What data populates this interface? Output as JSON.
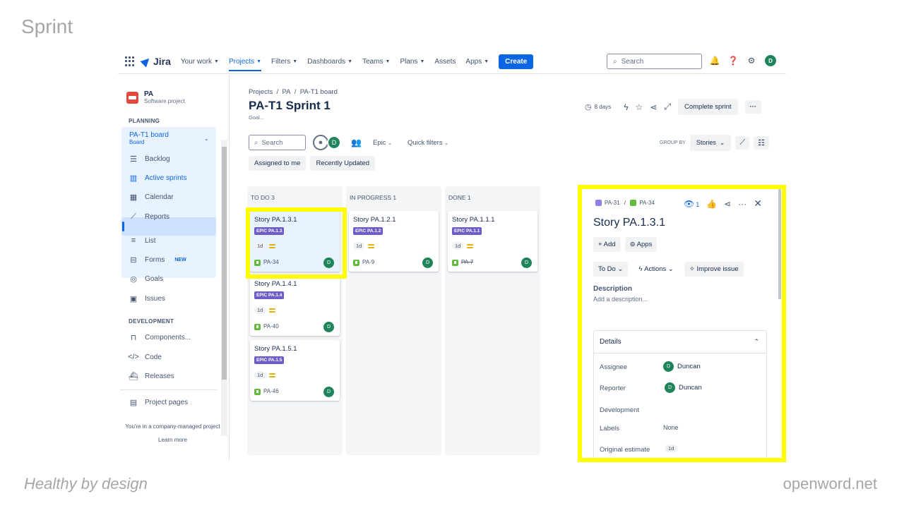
{
  "slide": {
    "title": "Sprint",
    "footer_left": "Healthy by design",
    "footer_right": "openword.net"
  },
  "topnav": {
    "logo": "Jira",
    "items": [
      "Your work",
      "Projects",
      "Filters",
      "Dashboards",
      "Teams",
      "Plans",
      "Assets",
      "Apps"
    ],
    "active": "Projects",
    "create": "Create",
    "search_placeholder": "Search",
    "avatar_initial": "D"
  },
  "sidebar": {
    "project_name": "PA",
    "project_type": "Software project",
    "planning_label": "PLANNING",
    "board_name": "PA-T1 board",
    "board_sub": "Board",
    "planning_items": [
      "Backlog",
      "Active sprints",
      "Calendar",
      "Reports"
    ],
    "other_items": [
      "List",
      "Forms",
      "Goals",
      "Issues"
    ],
    "forms_badge": "NEW",
    "development_label": "DEVELOPMENT",
    "dev_items": [
      "Components...",
      "Code",
      "Releases"
    ],
    "project_pages": "Project pages",
    "footer_text": "You're in a company-managed project",
    "learn_more": "Learn more"
  },
  "header": {
    "crumbs": [
      "Projects",
      "PA",
      "PA-T1 board"
    ],
    "title": "PA-T1 Sprint 1",
    "goal": "Goal...",
    "days": "8 days",
    "complete_sprint": "Complete sprint"
  },
  "filters": {
    "search_placeholder": "Search",
    "avatar_initial": "D",
    "epic": "Epic",
    "quick_filters": "Quick filters",
    "chips": [
      "Assigned to me",
      "Recently Updated"
    ],
    "group_by_label": "GROUP BY",
    "group_by_value": "Stories"
  },
  "columns": [
    {
      "title": "TO DO 3",
      "cards": [
        {
          "title": "Story PA.1.3.1",
          "epic": "EPIC PA.1.3",
          "estimate": "1d",
          "key": "PA-34",
          "assignee": "D",
          "done": false,
          "selected": true
        },
        {
          "title": "Story PA.1.4.1",
          "epic": "EPIC PA.1.4",
          "estimate": "1d",
          "key": "PA-40",
          "assignee": "D",
          "done": false,
          "selected": false
        },
        {
          "title": "Story PA.1.5.1",
          "epic": "EPIC PA.1.5",
          "estimate": "1d",
          "key": "PA-46",
          "assignee": "D",
          "done": false,
          "selected": false
        }
      ]
    },
    {
      "title": "IN PROGRESS 1",
      "cards": [
        {
          "title": "Story PA.1.2.1",
          "epic": "EPIC PA.1.2",
          "estimate": "1d",
          "key": "PA-9",
          "assignee": "D",
          "done": false,
          "selected": false
        }
      ]
    },
    {
      "title": "DONE 1",
      "cards": [
        {
          "title": "Story PA.1.1.1",
          "epic": "EPIC PA.1.1",
          "estimate": "1d",
          "key": "PA-7",
          "assignee": "D",
          "done": true,
          "selected": false
        }
      ]
    }
  ],
  "panel": {
    "parent_key": "PA-31",
    "issue_key": "PA-34",
    "watchers": "1",
    "title": "Story PA.1.3.1",
    "add": "Add",
    "apps": "Apps",
    "status": "To Do",
    "actions": "Actions",
    "improve": "Improve issue",
    "description_label": "Description",
    "description_placeholder": "Add a description...",
    "details_label": "Details",
    "assignee_label": "Assignee",
    "assignee": "Duncan",
    "reporter_label": "Reporter",
    "reporter": "Duncan",
    "development_label": "Development",
    "labels_label": "Labels",
    "labels_value": "None",
    "orig_est_label": "Original estimate",
    "orig_est_value": "1d"
  },
  "colors": {
    "highlight": "#ffff00",
    "accent": "#0c66e4",
    "epic": "#6e5dc6",
    "avatar": "#1f845a"
  }
}
